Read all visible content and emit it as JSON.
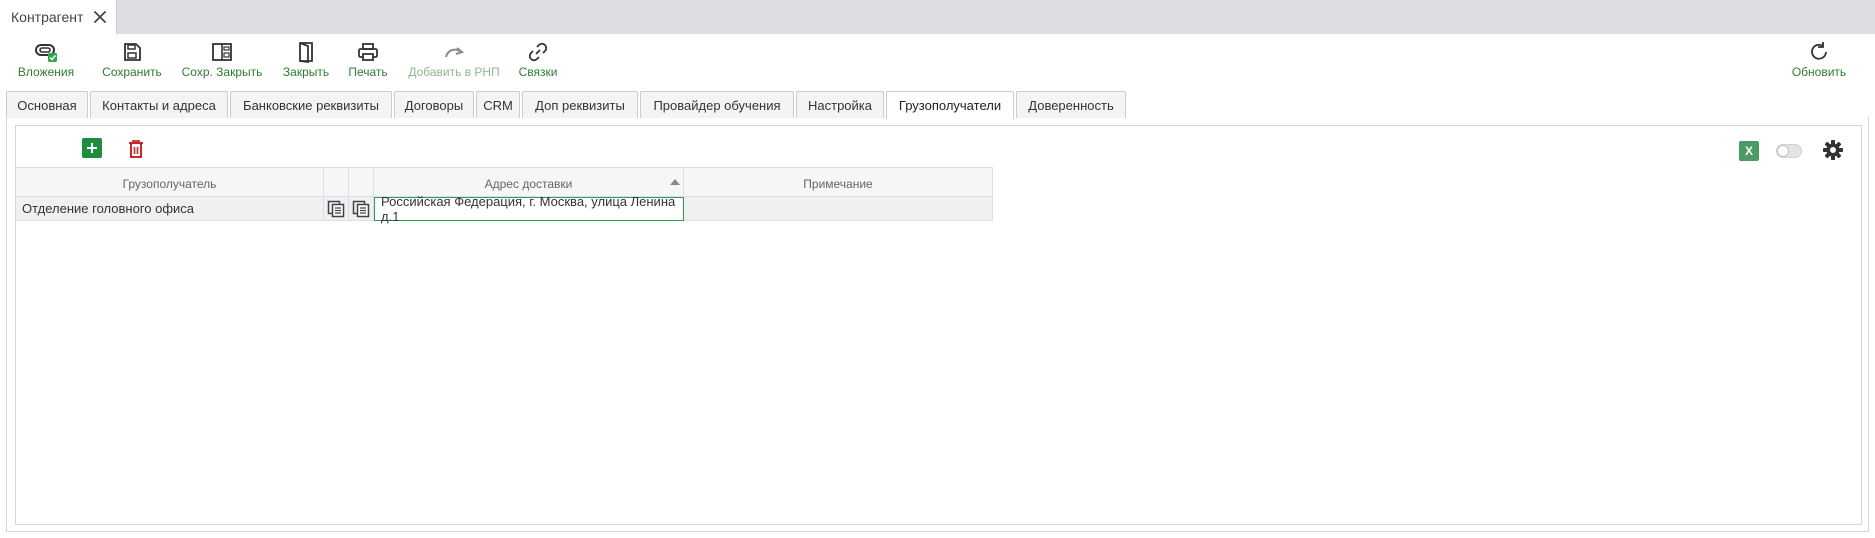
{
  "window": {
    "tab_title": "Контрагент"
  },
  "toolbar": {
    "attachments": "Вложения",
    "save": "Сохранить",
    "save_close": "Сохр. Закрыть",
    "close": "Закрыть",
    "print": "Печать",
    "add_rnp": "Добавить в РНП",
    "links": "Связки",
    "refresh": "Обновить"
  },
  "tabs": [
    {
      "label": "Основная"
    },
    {
      "label": "Контакты и адреса"
    },
    {
      "label": "Банковские реквизиты"
    },
    {
      "label": "Договоры"
    },
    {
      "label": "CRM"
    },
    {
      "label": "Доп реквизиты"
    },
    {
      "label": "Провайдер обучения"
    },
    {
      "label": "Настройка"
    },
    {
      "label": "Грузополучатели"
    },
    {
      "label": "Доверенность"
    }
  ],
  "active_tab": "Грузополучатели",
  "panel": {
    "excel_label": "X",
    "toggle_on": false
  },
  "grid": {
    "columns": [
      "Грузополучатель",
      "",
      "",
      "Адрес доставки",
      "Примечание"
    ],
    "sort_column": "Адрес доставки",
    "rows": [
      {
        "consignee": "Отделение головного офиса",
        "address": "Российская Федерация, г. Москва, улица Ленина д.1",
        "note": ""
      }
    ]
  },
  "colors": {
    "accent": "#2e7d32",
    "add_button": "#1e8e3e",
    "delete_button": "#c62828",
    "excel": "#4c9a66"
  }
}
